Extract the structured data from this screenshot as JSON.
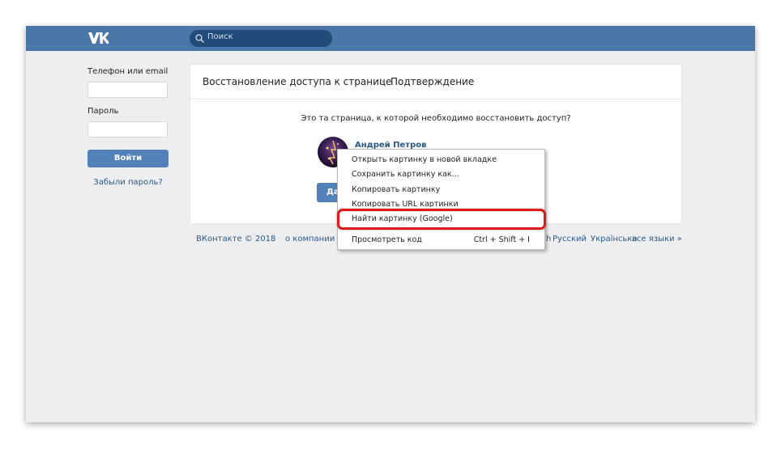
{
  "header": {
    "logo_icon": "vk-logo-icon",
    "search_placeholder": "Поиск"
  },
  "login": {
    "phone_label": "Телефон или email",
    "phone_value": "",
    "password_label": "Пароль",
    "password_value": "",
    "login_button": "Войти",
    "forgot_link": "Забыли пароль?"
  },
  "panel": {
    "breadcrumb_1": "Восстановление доступа к странице",
    "breadcrumb_2": "Подтверждение",
    "question": "Это та страница, к которой необходимо восстановить доступ?",
    "user_name": "Андрей Петров",
    "confirm_button": "Да"
  },
  "footer": {
    "copyright": "ВКонтакте © 2018",
    "about": "о компании",
    "lang_partial": "h",
    "lang_ru": "Русский",
    "lang_ua": "Українська",
    "lang_all": "все языки »"
  },
  "context_menu": {
    "items": [
      "Открыть картинку в новой вкладке",
      "Сохранить картинку как...",
      "Копировать картинку",
      "Копировать URL картинки",
      "Найти картинку (Google)",
      "Просмотреть код"
    ],
    "shortcut": "Ctrl + Shift + I"
  },
  "colors": {
    "topbar": "#4a76a8",
    "accent": "#5181b8",
    "link": "#2a5885",
    "highlight": "#e01b1b"
  }
}
